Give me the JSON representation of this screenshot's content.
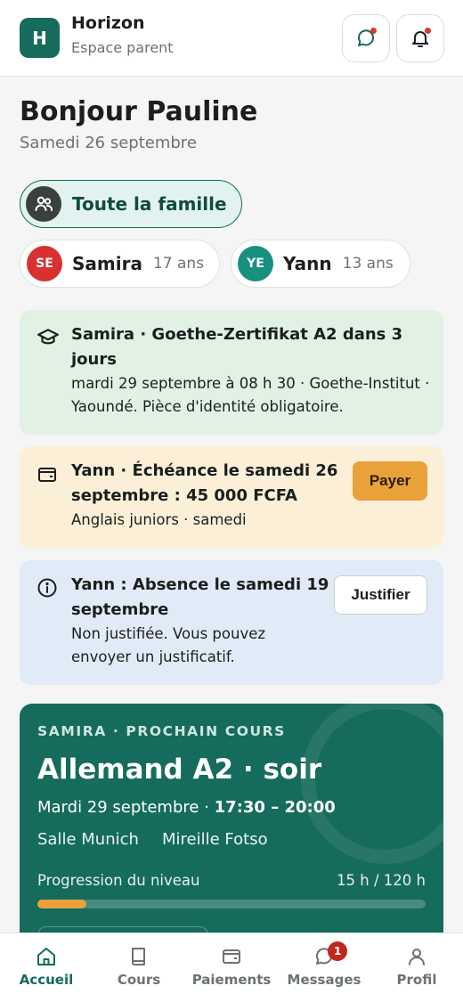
{
  "header": {
    "logo_letter": "H",
    "app_name": "Horizon",
    "subtitle": "Espace parent"
  },
  "greeting": {
    "title": "Bonjour Pauline",
    "date": "Samedi 26 septembre"
  },
  "filters": {
    "family_label": "Toute la famille",
    "children": [
      {
        "initials": "SE",
        "name": "Samira",
        "age": "17 ans",
        "color": "#d93030"
      },
      {
        "initials": "YE",
        "name": "Yann",
        "age": "13 ans",
        "color": "#179080"
      }
    ]
  },
  "alerts": [
    {
      "icon": "graduation-cap-icon",
      "title": "Samira · Goethe-Zertifikat A2 dans 3 jours",
      "text": "mardi 29 septembre à 08 h 30 · Goethe-Institut · Yaoundé. Pièce d'identité obligatoire.",
      "bg": "#e1f1e4"
    },
    {
      "icon": "wallet-icon",
      "title": "Yann · Échéance le samedi 26 septembre : 45 000 FCFA",
      "text": "Anglais juniors · samedi",
      "action": "Payer",
      "bg": "#fcefd8"
    },
    {
      "icon": "info-icon",
      "title": "Yann : Absence le samedi 19 septembre",
      "text": "Non justifiée. Vous pouvez envoyer un justificatif.",
      "action": "Justifier",
      "bg": "#e1ebf8"
    }
  ],
  "next_course": {
    "eyebrow": "SAMIRA · PROCHAIN COURS",
    "title": "Allemand A2 · soir",
    "date": "Mardi 29 septembre ·",
    "time": "17:30 – 20:00",
    "room": "Salle Munich",
    "teacher": "Mireille Fotso",
    "progress_label": "Progression du niveau",
    "progress_value": "15 h / 120 h",
    "progress_fraction": 0.125
  },
  "nav": {
    "items": [
      {
        "label": "Accueil",
        "icon": "home-icon",
        "active": true
      },
      {
        "label": "Cours",
        "icon": "book-icon",
        "active": false
      },
      {
        "label": "Paiements",
        "icon": "wallet-icon",
        "active": false
      },
      {
        "label": "Messages",
        "icon": "message-icon",
        "active": false,
        "badge": "1"
      },
      {
        "label": "Profil",
        "icon": "user-icon",
        "active": false
      }
    ]
  },
  "colors": {
    "brand": "#156b5c",
    "accent": "#e9a13a",
    "alert_dot": "#d93a2e"
  }
}
